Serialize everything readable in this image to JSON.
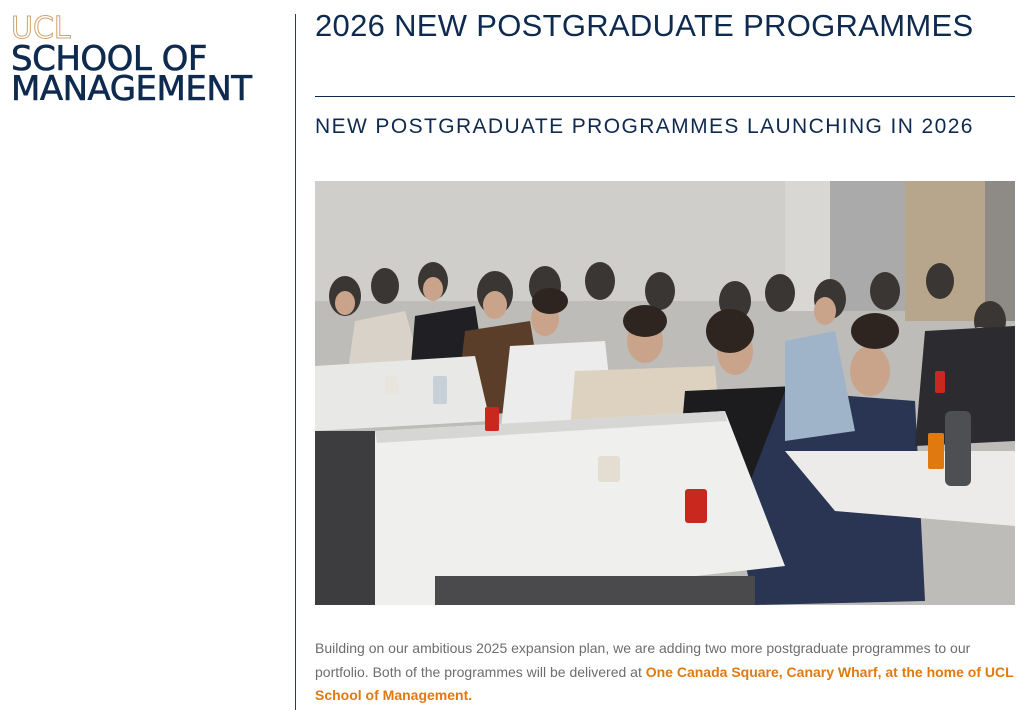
{
  "logo": {
    "ucl": "UCL",
    "line1": "SCHOOL OF",
    "line2": "MANAGEMENT"
  },
  "page": {
    "title": "2026 NEW POSTGRADUATE PROGRAMMES",
    "subtitle": "NEW POSTGRADUATE PROGRAMMES LAUNCHING IN 2026"
  },
  "body": {
    "intro": "Building on our ambitious 2025 expansion plan, we are adding two more postgraduate programmes to our portfolio. Both of the programmes will be delivered at ",
    "highlight": "One Canada Square, Canary Wharf, at the home of UCL School of Management."
  },
  "colors": {
    "navy": "#0e2a4f",
    "gold": "#d1a36b",
    "highlight": "#e07a10",
    "body_text": "#6d6d6d"
  }
}
